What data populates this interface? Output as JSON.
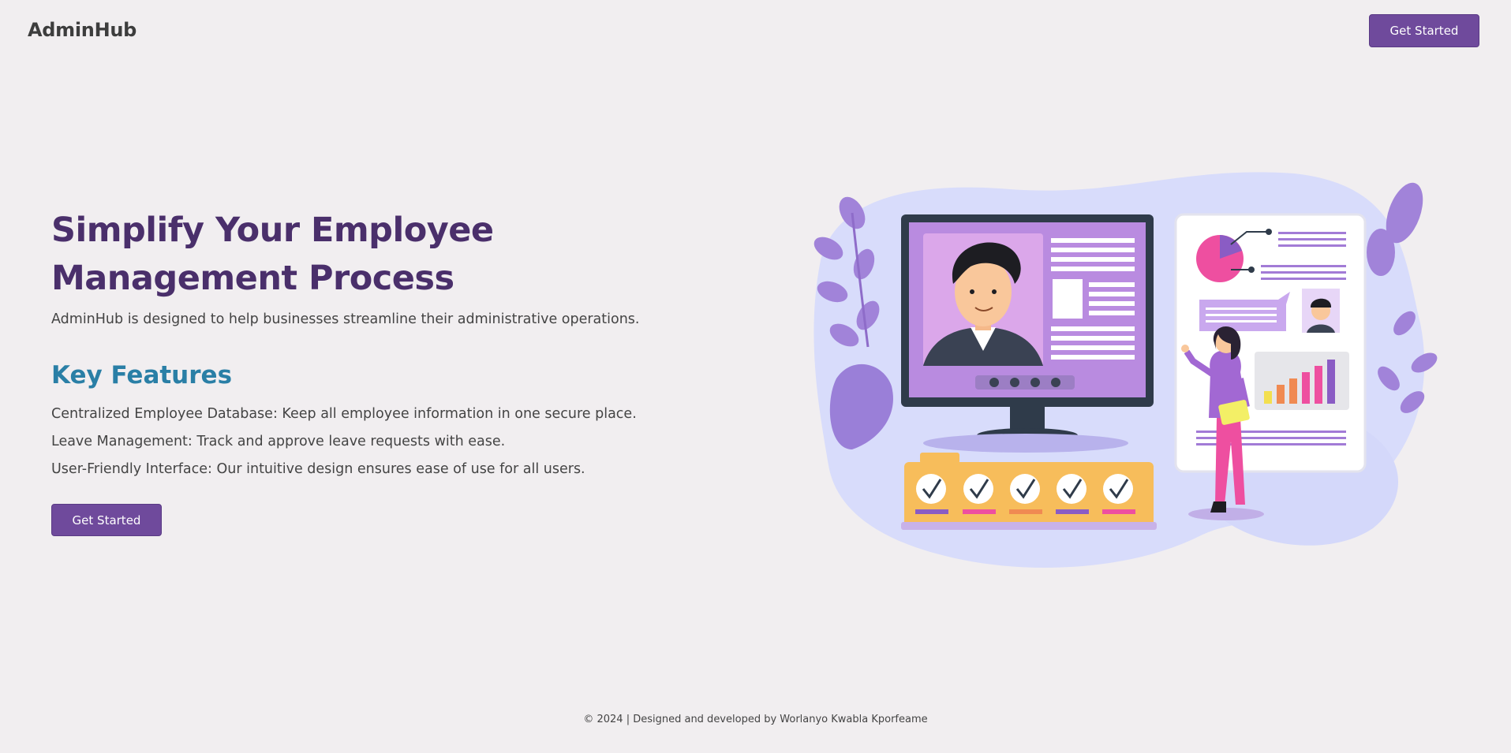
{
  "header": {
    "brand": "AdminHub",
    "cta_label": "Get Started"
  },
  "hero": {
    "title": "Simplify Your Employee Management Process",
    "subtitle": "AdminHub is designed to help businesses streamline their administrative operations.",
    "features_title": "Key Features",
    "features": [
      "Centralized Employee Database: Keep all employee information in one secure place.",
      "Leave Management: Track and approve leave requests with ease.",
      "User-Friendly Interface: Our intuitive design ensures ease of use for all users."
    ],
    "cta_label": "Get Started"
  },
  "illustration": {
    "name": "employee-management-illustration",
    "checklist_items": 5
  },
  "footer": {
    "text": "© 2024 | Designed and developed by Worlanyo Kwabla Kporfeame"
  },
  "colors": {
    "background": "#f1eef0",
    "primary": "#6f4a9c",
    "title": "#4a2f6b",
    "accent": "#2a7fa6"
  }
}
